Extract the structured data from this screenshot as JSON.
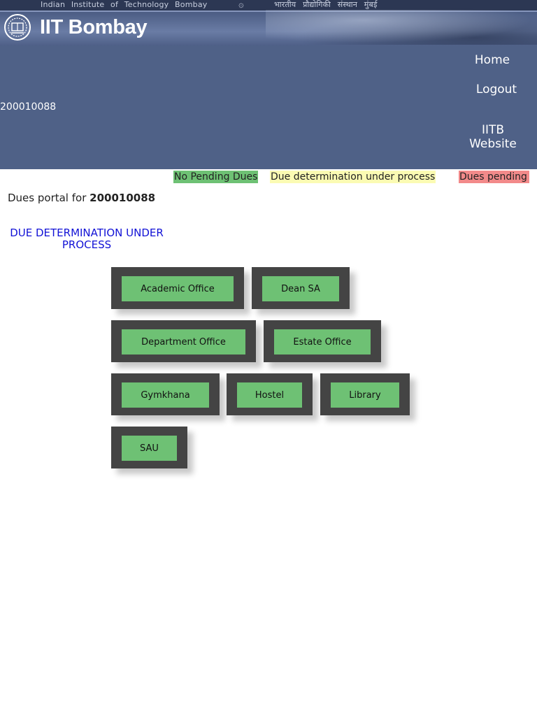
{
  "banner": {
    "institute_en": "Indian Institute of Technology Bombay",
    "institute_hi": "भारतीय प्रौद्योगिकी संस्थान मुंबई",
    "logo_text": "IIT Bombay",
    "gear_icon": "gear-icon"
  },
  "header": {
    "user_id": "200010088",
    "nav": {
      "home": "Home",
      "logout": "Logout",
      "iitb_website": "IITB Website"
    }
  },
  "legend": {
    "no_pending": "No Pending Dues",
    "under_process": "Due determination under process",
    "pending": "Dues pending",
    "colors": {
      "no_pending": "#6ec174",
      "under_process": "#fbfbb3",
      "pending": "#f28a8a"
    }
  },
  "portal": {
    "label": "Dues portal for",
    "roll_no": "200010088",
    "status": "DUE DETERMINATION UNDER PROCESS"
  },
  "offices": [
    {
      "label": "Academic Office",
      "status": "No Pending Dues"
    },
    {
      "label": "Dean SA",
      "status": "No Pending Dues"
    },
    {
      "label": "Department Office",
      "status": "No Pending Dues"
    },
    {
      "label": "Estate Office",
      "status": "No Pending Dues"
    },
    {
      "label": "Gymkhana",
      "status": "No Pending Dues"
    },
    {
      "label": "Hostel",
      "status": "No Pending Dues"
    },
    {
      "label": "Library",
      "status": "No Pending Dues"
    },
    {
      "label": "SAU",
      "status": "No Pending Dues"
    }
  ]
}
